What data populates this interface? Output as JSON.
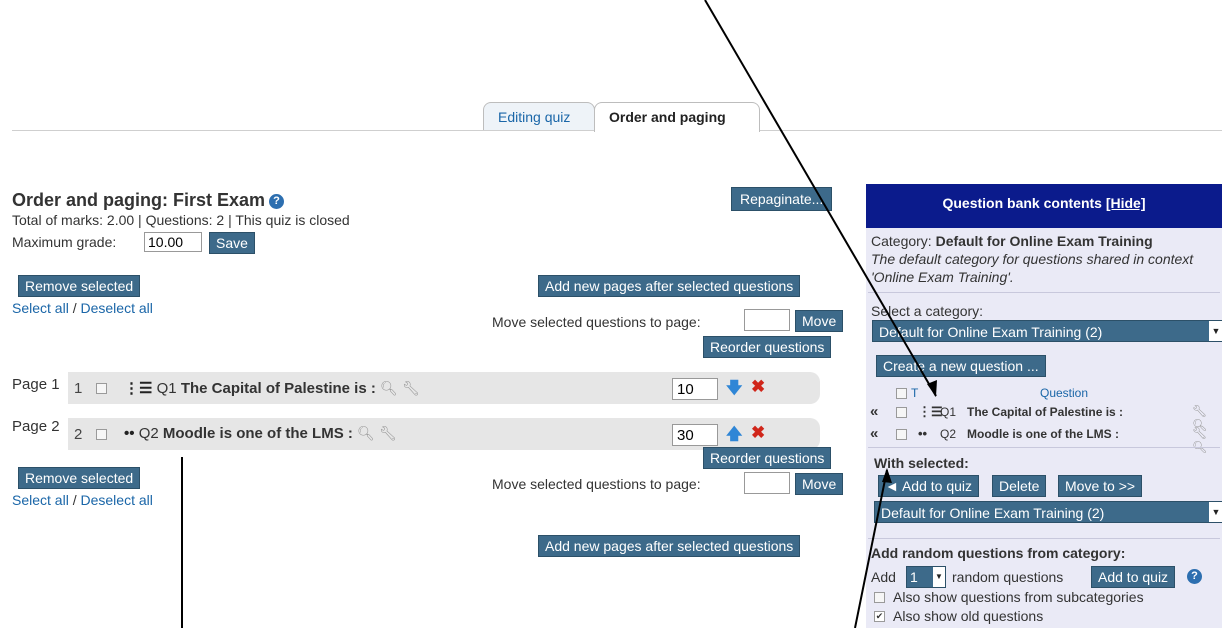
{
  "tabs": {
    "editing": "Editing quiz",
    "order": "Order and paging"
  },
  "header": {
    "title": "Order and paging: First Exam",
    "summary": "Total of marks: 2.00 | Questions: 2 | This quiz is closed",
    "max_grade_label": "Maximum grade:",
    "max_grade_value": "10.00",
    "save": "Save",
    "repaginate": "Repaginate..."
  },
  "actions": {
    "remove_selected": "Remove selected",
    "select_all": "Select all",
    "slash": " / ",
    "deselect_all": "Deselect all",
    "add_pages": "Add new pages after selected questions",
    "move_to_page_label": "Move selected questions to page:",
    "move": "Move",
    "reorder": "Reorder questions"
  },
  "pages": [
    {
      "label": "Page 1",
      "num": "1",
      "qid": "Q1",
      "text": "The Capital of Palestine is :",
      "mark": "10",
      "arrow": "down",
      "icon": "multichoice-icon"
    },
    {
      "label": "Page 2",
      "num": "2",
      "qid": "Q2",
      "text": "Moodle is one of the LMS :",
      "mark": "30",
      "arrow": "up",
      "icon": "truefalse-icon"
    }
  ],
  "bank": {
    "title": "Question bank contents",
    "hide": "[Hide]",
    "category_label": "Category:",
    "category_name": "Default for Online Exam Training",
    "category_desc": "The default category for questions shared in context 'Online Exam Training'.",
    "select_category_label": "Select a category:",
    "selected_category": "Default for Online Exam Training (2)",
    "create_new": "Create a new question ...",
    "col_t": "T",
    "col_question": "Question",
    "rows": [
      {
        "qid": "Q1",
        "text": "The Capital of Palestine is :"
      },
      {
        "qid": "Q2",
        "text": "Moodle is one of the LMS :"
      }
    ],
    "with_selected": "With selected:",
    "add_to_quiz": "◄ Add to quiz",
    "delete": "Delete",
    "move_to": "Move to >>",
    "move_category": "Default for Online Exam Training (2)",
    "random_heading": "Add random questions from category:",
    "add_label": "Add",
    "random_count": "1",
    "random_suffix": "random questions",
    "add_to_quiz_random": "Add to quiz",
    "subcats": "Also show questions from subcategories",
    "old_questions": "Also show old questions"
  }
}
